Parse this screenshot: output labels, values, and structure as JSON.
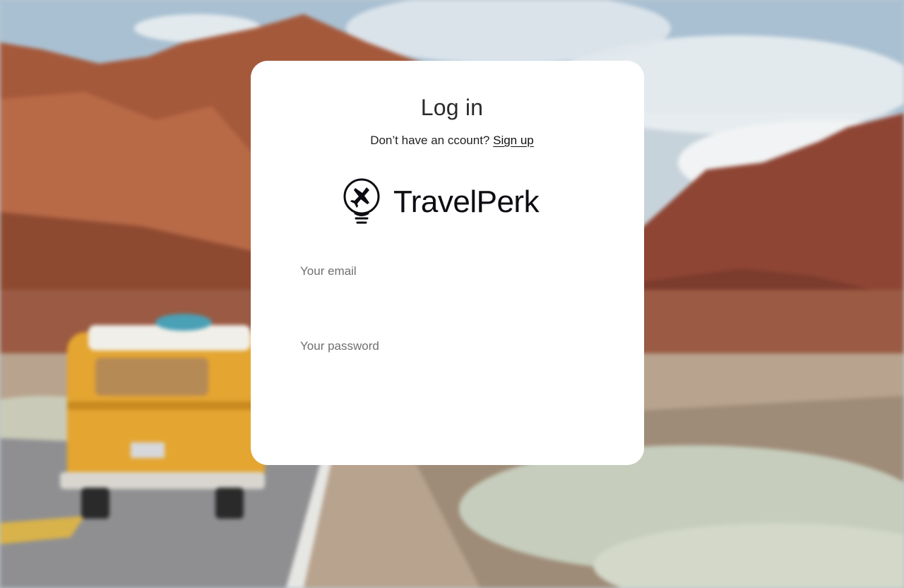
{
  "login": {
    "title": "Log in",
    "signup_prompt": "Don’t have an ccount?",
    "signup_link": "Sign up"
  },
  "logo": {
    "text": "TravelPerk",
    "icon": "lightbulb-plane-icon"
  },
  "form": {
    "email_placeholder": "Your email",
    "password_placeholder": "Your password"
  },
  "background": {
    "icon": "desert-road-van-photo"
  },
  "colors": {
    "card": "#ffffff",
    "text": "#2b2b2b",
    "placeholder": "#6f6f6f"
  }
}
